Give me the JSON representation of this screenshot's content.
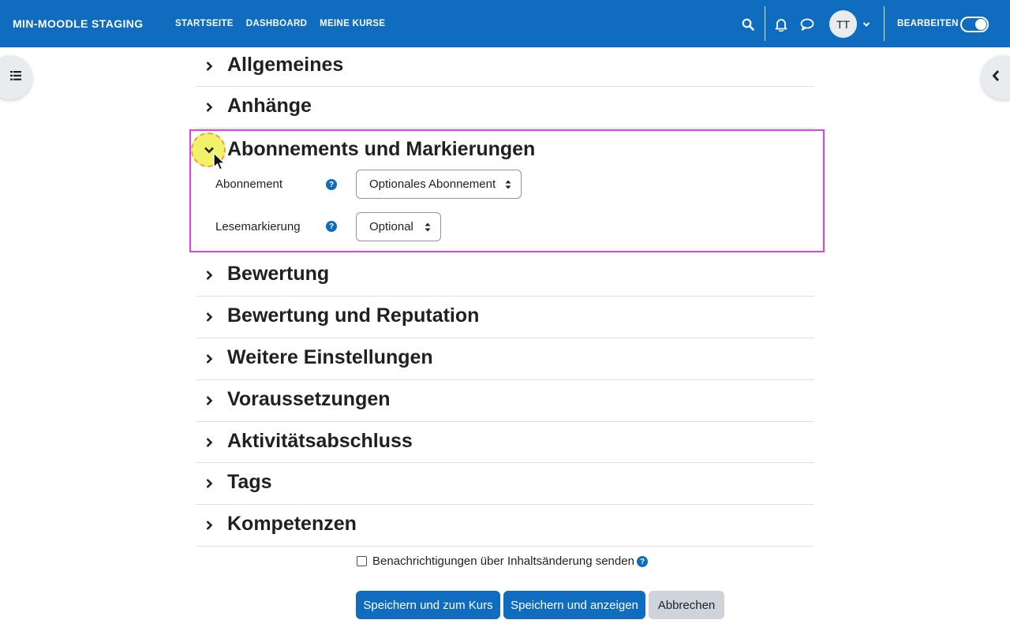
{
  "header": {
    "brand": "MIN-MOODLE STAGING",
    "nav": [
      "STARTSEITE",
      "DASHBOARD",
      "MEINE KURSE"
    ],
    "avatar_initials": "TT",
    "edit_mode_label": "BEARBEITEN",
    "edit_mode_on": true,
    "color": "#0f6cbf"
  },
  "sections": [
    {
      "title": "Allgemeines",
      "expanded": false
    },
    {
      "title": "Anhänge",
      "expanded": false
    },
    {
      "title": "Abonnements und Markierungen",
      "expanded": true
    },
    {
      "title": "Bewertung",
      "expanded": false
    },
    {
      "title": "Bewertung und Reputation",
      "expanded": false
    },
    {
      "title": "Weitere Einstellungen",
      "expanded": false
    },
    {
      "title": "Voraussetzungen",
      "expanded": false
    },
    {
      "title": "Aktivitätsabschluss",
      "expanded": false
    },
    {
      "title": "Tags",
      "expanded": false
    },
    {
      "title": "Kompetenzen",
      "expanded": false
    }
  ],
  "subscription": {
    "abonnement_label": "Abonnement",
    "abonnement_value": "Optionales Abonnement",
    "lesemarkierung_label": "Lesemarkierung",
    "lesemarkierung_value": "Optional"
  },
  "notify": {
    "label": "Benachrichtigungen über Inhaltsänderung senden",
    "checked": false
  },
  "buttons": {
    "save_course": "Speichern und zum Kurs",
    "save_show": "Speichern und anzeigen",
    "cancel": "Abbrechen"
  },
  "icons": {
    "search": "search-icon",
    "bell": "bell-icon",
    "chat": "chat-icon",
    "help": "?"
  },
  "highlight_color": "#e040e8"
}
